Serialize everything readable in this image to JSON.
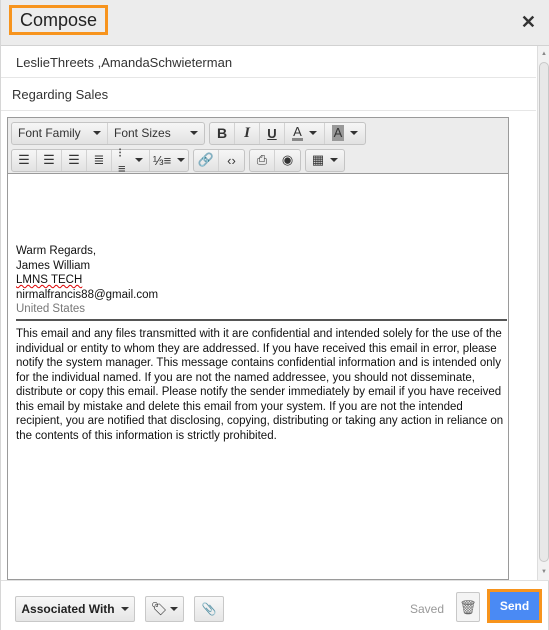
{
  "header": {
    "title": "Compose",
    "close_icon": "close-icon"
  },
  "compose": {
    "to": "LeslieThreets ,AmandaSchwieterman",
    "subject": "Regarding Sales"
  },
  "toolbar": {
    "font_family": "Font Family",
    "font_sizes": "Font Sizes",
    "bold": "B",
    "italic": "I",
    "underline": "U",
    "font_color": "A",
    "bg_color": "A",
    "icons": [
      "align-left-icon",
      "align-center-icon",
      "align-right-icon",
      "align-justify-icon",
      "bullet-list-icon",
      "numbered-list-icon",
      "link-icon",
      "code-icon",
      "print-icon",
      "preview-icon",
      "table-icon"
    ]
  },
  "body": {
    "signature": {
      "closing": "Warm Regards,",
      "name": "James William",
      "company": "LMNS TECH",
      "email": "nirmalfrancis88@gmail.com",
      "country": "United States"
    },
    "disclaimer": "This email and any files transmitted with it are confidential and intended solely for the use of the individual or entity to whom they are addressed. If you have received this email in error, please notify the system manager. This message contains confidential information and is intended only for the individual named. If you are not the named addressee, you should not disseminate, distribute or copy this email. Please notify the sender immediately by email if you have received this email by mistake and delete this email from your system. If you are not the intended recipient, you are notified that disclosing, copying, distributing or taking any action in reliance on the contents of this information is strictly prohibited."
  },
  "footer": {
    "associated_with": "Associated With",
    "saved_status": "Saved",
    "send": "Send"
  },
  "colors": {
    "highlight": "#f7941d",
    "send_bg": "#4a8af4"
  }
}
